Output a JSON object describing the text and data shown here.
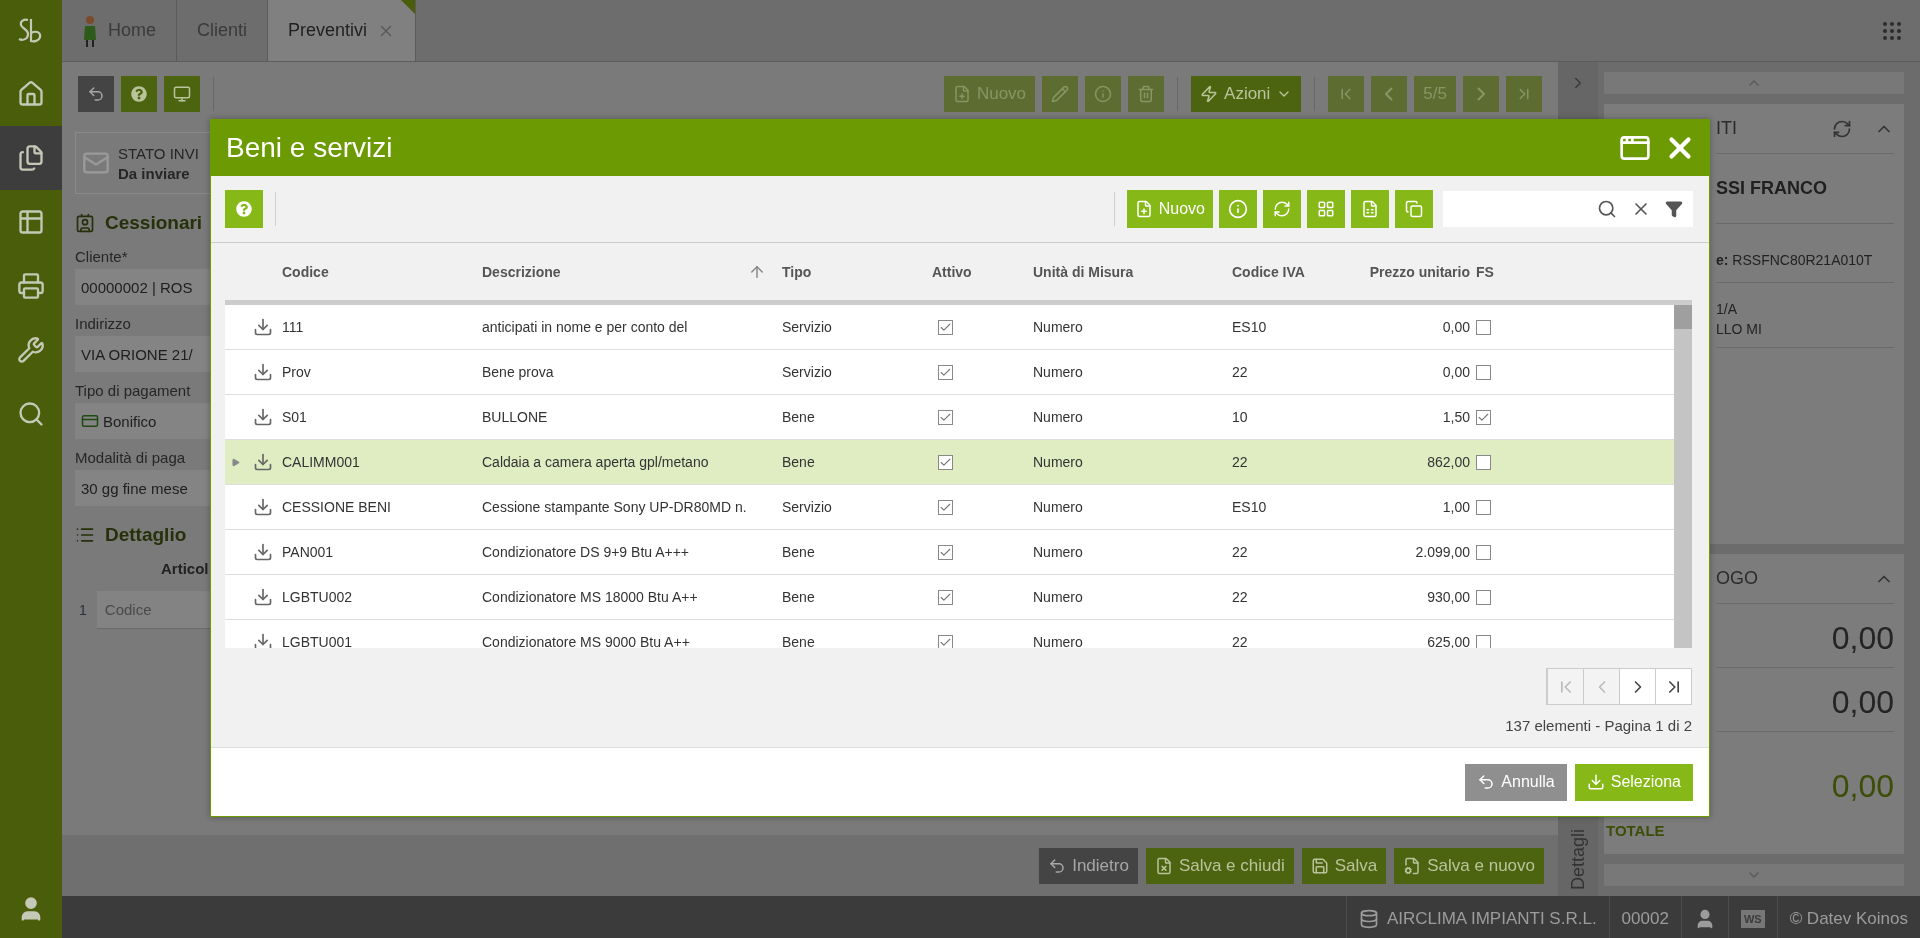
{
  "sidebar": {
    "items": [
      {
        "kind": "home",
        "selected": false
      },
      {
        "kind": "documents",
        "selected": true
      },
      {
        "kind": "table",
        "selected": false
      },
      {
        "kind": "printer",
        "selected": false
      },
      {
        "kind": "tools",
        "selected": false
      },
      {
        "kind": "search",
        "selected": false
      }
    ]
  },
  "tabs": [
    {
      "label": "Home",
      "selected": false,
      "kind": "home"
    },
    {
      "label": "Clienti",
      "selected": false,
      "kind": "plain"
    },
    {
      "label": "Preventivi",
      "selected": true,
      "kind": "closable"
    }
  ],
  "record_toolbar": {
    "items": [
      {
        "kind": "new",
        "label": "Nuovo",
        "disabled": true
      },
      {
        "kind": "edit",
        "disabled": true
      },
      {
        "kind": "info",
        "disabled": true
      },
      {
        "kind": "delete",
        "disabled": true
      },
      {
        "kind": "actions",
        "label": "Azioni",
        "disabled": false
      },
      {
        "kind": "first",
        "disabled": true
      },
      {
        "kind": "prev",
        "disabled": true
      },
      {
        "kind": "position",
        "label": "5/5",
        "disabled": true
      },
      {
        "kind": "next",
        "disabled": true
      },
      {
        "kind": "last",
        "disabled": true
      }
    ]
  },
  "send_status": {
    "label": "STATO INVI",
    "value": "Da inviare"
  },
  "form": {
    "title": "Cessionari",
    "fields": [
      {
        "label": "Cliente*",
        "value": "00000002 | ROS",
        "kind": "text"
      },
      {
        "label": "Indirizzo",
        "value": "VIA ORIONE 21/",
        "kind": "text"
      },
      {
        "label": "Tipo di pagament",
        "value": "Bonifico",
        "kind": "payment"
      },
      {
        "label": "Modalità di paga",
        "value": "30 gg fine mese",
        "kind": "text"
      }
    ]
  },
  "detail": {
    "title": "Dettaglio",
    "column": "Articol",
    "row_number": "1",
    "code_placeholder": "Codice"
  },
  "action_buttons": [
    {
      "label": "Indietro",
      "kind": "back"
    },
    {
      "label": "Salva e chiudi",
      "kind": "save-close"
    },
    {
      "label": "Salva",
      "kind": "save"
    },
    {
      "label": "Salva e nuovo",
      "kind": "save-new"
    }
  ],
  "side_tab": "Dettagli",
  "right_panel": {
    "customer": {
      "title": "ITI",
      "name": "SSI FRANCO",
      "tax_code": "**e:** RSSFNC80R21A010T",
      "address": [
        "1/A",
        "LLO MI"
      ]
    },
    "summary": {
      "title": "OGO",
      "amounts": [
        "0,00",
        "0,00"
      ],
      "total_label": "TOTALE",
      "total": "0,00"
    }
  },
  "status_bar": {
    "company": "AIRCLIMA IMPIANTI S.R.L.",
    "code": "00002",
    "badge": "WS",
    "copyright": "© Datev Koinos"
  },
  "dialog": {
    "title": "Beni e servizi",
    "new_label": "Nuovo",
    "columns": [
      {
        "label": "Codice",
        "sorted": false
      },
      {
        "label": "Descrizione",
        "sorted": true
      },
      {
        "label": "Tipo",
        "sorted": false
      },
      {
        "label": "Attivo",
        "sorted": false
      },
      {
        "label": "Unità di Misura",
        "sorted": false
      },
      {
        "label": "Codice IVA",
        "sorted": false
      },
      {
        "label": "Prezzo unitario",
        "sorted": false
      },
      {
        "label": "FS",
        "sorted": false
      }
    ],
    "rows": [
      {
        "code": "111",
        "description": "anticipati in nome e per conto del",
        "type": "Servizio",
        "active": true,
        "unit": "Numero",
        "vat": "ES10",
        "price": "0,00",
        "fs": false,
        "selected": false
      },
      {
        "code": "Prov",
        "description": "Bene prova",
        "type": "Servizio",
        "active": true,
        "unit": "Numero",
        "vat": "22",
        "price": "0,00",
        "fs": false,
        "selected": false
      },
      {
        "code": "S01",
        "description": "BULLONE",
        "type": "Bene",
        "active": true,
        "unit": "Numero",
        "vat": "10",
        "price": "1,50",
        "fs": true,
        "selected": false
      },
      {
        "code": "CALIMM001",
        "description": "Caldaia a camera aperta gpl/metano",
        "type": "Bene",
        "active": true,
        "unit": "Numero",
        "vat": "22",
        "price": "862,00",
        "fs": false,
        "selected": true
      },
      {
        "code": "CESSIONE BENI",
        "description": "Cessione stampante Sony UP-DR80MD n.",
        "type": "Servizio",
        "active": true,
        "unit": "Numero",
        "vat": "ES10",
        "price": "1,00",
        "fs": false,
        "selected": false
      },
      {
        "code": "PAN001",
        "description": "Condizionatore DS 9+9 Btu A+++",
        "type": "Bene",
        "active": true,
        "unit": "Numero",
        "vat": "22",
        "price": "2.099,00",
        "fs": false,
        "selected": false
      },
      {
        "code": "LGBTU002",
        "description": "Condizionatore MS 18000 Btu A++",
        "type": "Bene",
        "active": true,
        "unit": "Numero",
        "vat": "22",
        "price": "930,00",
        "fs": false,
        "selected": false
      },
      {
        "code": "LGBTU001",
        "description": "Condizionatore MS 9000 Btu A++",
        "type": "Bene",
        "active": true,
        "unit": "Numero",
        "vat": "22",
        "price": "625,00",
        "fs": false,
        "selected": false
      }
    ],
    "pager": {
      "buttons": [
        {
          "kind": "first",
          "disabled": true
        },
        {
          "kind": "prev",
          "disabled": true
        },
        {
          "kind": "next",
          "disabled": false
        },
        {
          "kind": "last",
          "disabled": false
        }
      ],
      "summary": "137 elementi - Pagina 1 di 2"
    },
    "buttons": [
      {
        "label": "Annulla",
        "kind": "cancel"
      },
      {
        "label": "Seleziona",
        "kind": "select"
      }
    ]
  }
}
